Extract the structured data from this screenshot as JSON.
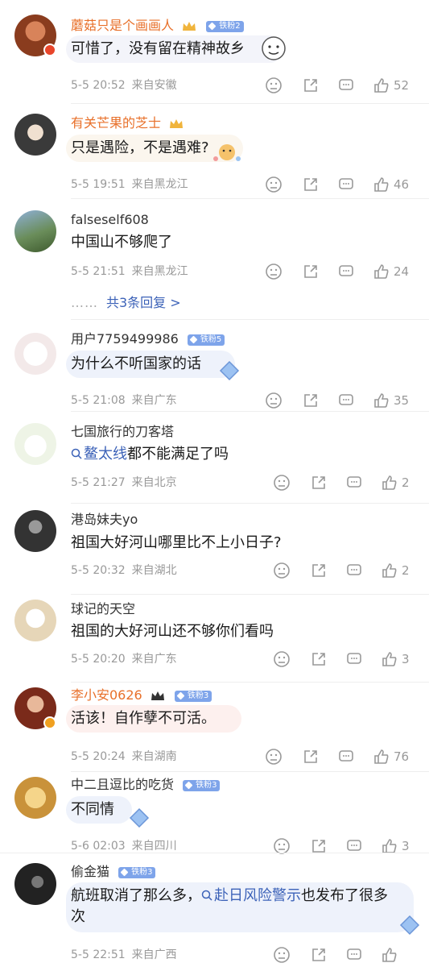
{
  "comments": [
    {
      "name": "蘑菇只是个画画人",
      "name_color": "orange",
      "badge": "铁粉2",
      "crown": true,
      "text": "可惜了，没有留在精神故乡",
      "date": "5-5 20:52",
      "location": "来自安徽",
      "likes": "52",
      "accent": "#b85a2c",
      "bubble": "#f3f4fa"
    },
    {
      "name": "有关芒果的芝士",
      "name_color": "orange",
      "badge": "",
      "crown": true,
      "text": "只是遇险，不是遇难?",
      "date": "5-5 19:51",
      "location": "来自黑龙江",
      "likes": "46",
      "accent": "#4a4a4a",
      "bubble": "#fbf6ee"
    },
    {
      "name": "falseself608",
      "name_color": "gray",
      "badge": "",
      "text": "中国山不够爬了",
      "date": "5-5 21:51",
      "location": "来自黑龙江",
      "likes": "24",
      "more": "共3条回复 >",
      "accent": "#6a8d5a"
    },
    {
      "name": "用户7759499986",
      "name_color": "gray",
      "badge": "铁粉5",
      "text": "为什么不听国家的话",
      "date": "5-5 21:08",
      "location": "来自广东",
      "likes": "35",
      "accent": "#a83232",
      "bubble": "#eef2fb"
    },
    {
      "name": "七国旅行的刀客塔",
      "name_color": "gray",
      "badge": "",
      "link": "鳌太线",
      "text": "都不能满足了吗",
      "date": "5-5 21:27",
      "location": "来自北京",
      "likes": "2",
      "accent": "#5b7a3a"
    },
    {
      "name": "港岛妹夫yo",
      "name_color": "gray",
      "badge": "",
      "text": "祖国大好河山哪里比不上小日子?",
      "date": "5-5 20:32",
      "location": "来自湖北",
      "likes": "2",
      "accent": "#333333"
    },
    {
      "name": "球记的天空",
      "name_color": "gray",
      "badge": "",
      "text": "祖国的大好河山还不够你们看吗",
      "date": "5-5 20:20",
      "location": "来自广东",
      "likes": "3",
      "accent": "#c9a76a"
    },
    {
      "name": "李小安0626",
      "name_color": "orange",
      "badge": "铁粉3",
      "crown": true,
      "text": "活该！自作孽不可活。",
      "date": "5-5 20:24",
      "location": "来自湖南",
      "likes": "76",
      "accent": "#7a2a1a",
      "bubble": "#fdf0ee"
    },
    {
      "name": "中二且逗比的吃货",
      "name_color": "gray",
      "badge": "铁粉3",
      "text": "不同情",
      "date": "5-6 02:03",
      "location": "来自四川",
      "likes": "3",
      "accent": "#d8a84a",
      "bubble": "#eef2fb"
    },
    {
      "name": "偷金猫",
      "name_color": "gray",
      "badge": "铁粉3",
      "text": "航班取消了那么多，",
      "link": "赴日风险警示",
      "text2": "也发布了很多",
      "text3": "次",
      "date": "5-5 22:51",
      "location": "来自广西",
      "likes": "",
      "accent": "#2a2a2a",
      "bubble": "#eef2fb"
    }
  ],
  "icons": [
    "unhappy-icon",
    "share-icon",
    "comment-icon",
    "like-icon"
  ]
}
